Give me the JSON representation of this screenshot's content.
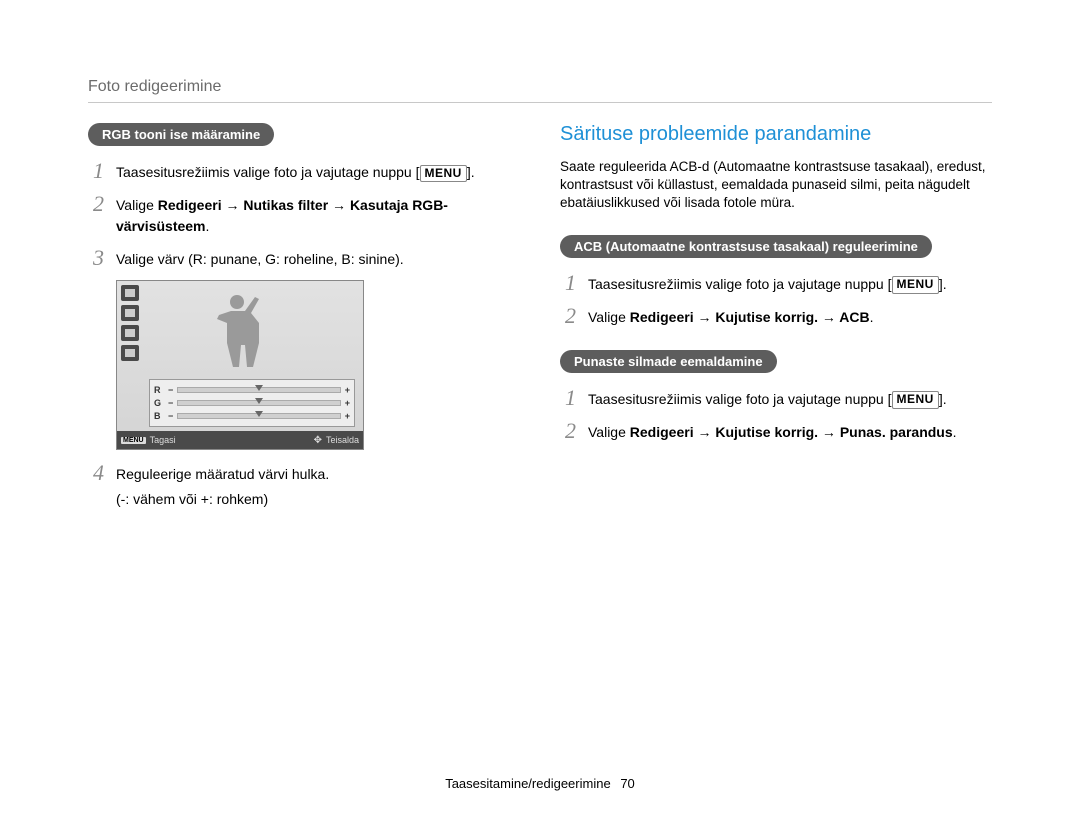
{
  "page_title": "Foto redigeerimine",
  "left": {
    "pill": "RGB tooni ise määramine",
    "step1_pre": "Taasesitusrežiimis valige foto ja vajutage nuppu",
    "step1_menu": "MENU",
    "step1_post": ".",
    "step2_pre": "Valige ",
    "step2_bold": "Redigeeri → Nutikas filter → Kasutaja RGB-värvisüsteem",
    "step2_post": ".",
    "step3": "Valige värv (R: punane, G: roheline, B: sinine).",
    "step4_line1": "Reguleerige määratud värvi hulka.",
    "step4_line2": "(-: vähem või +: rohkem)",
    "cam": {
      "back": "Tagasi",
      "move": "Teisalda",
      "menu": "MENU",
      "r": "R",
      "g": "G",
      "b": "B",
      "minus": "−",
      "plus": "+"
    }
  },
  "right": {
    "title": "Särituse probleemide parandamine",
    "intro": "Saate reguleerida ACB-d (Automaatne kontrastsuse tasakaal), eredust, kontrastsust või küllastust, eemaldada punaseid silmi, peita nägudelt ebatäiuslikkused või lisada fotole müra.",
    "pill_acb": "ACB (Automaatne kontrastsuse tasakaal) reguleerimine",
    "acb_step1_pre": "Taasesitusrežiimis valige foto ja vajutage nuppu",
    "acb_step1_menu": "MENU",
    "acb_step1_post": ".",
    "acb_step2_pre": "Valige ",
    "acb_step2_bold": "Redigeeri → Kujutise korrig. → ACB",
    "acb_step2_post": ".",
    "pill_red": "Punaste silmade eemaldamine",
    "red_step1_pre": "Taasesitusrežiimis valige foto ja vajutage nuppu",
    "red_step1_menu": "MENU",
    "red_step1_post": ".",
    "red_step2_pre": "Valige ",
    "red_step2_bold": "Redigeeri → Kujutise korrig. → Punas. parandus",
    "red_step2_post": "."
  },
  "numbers": {
    "n1": "1",
    "n2": "2",
    "n3": "3",
    "n4": "4"
  },
  "footer": {
    "section": "Taasesitamine/redigeerimine",
    "page": "70"
  }
}
